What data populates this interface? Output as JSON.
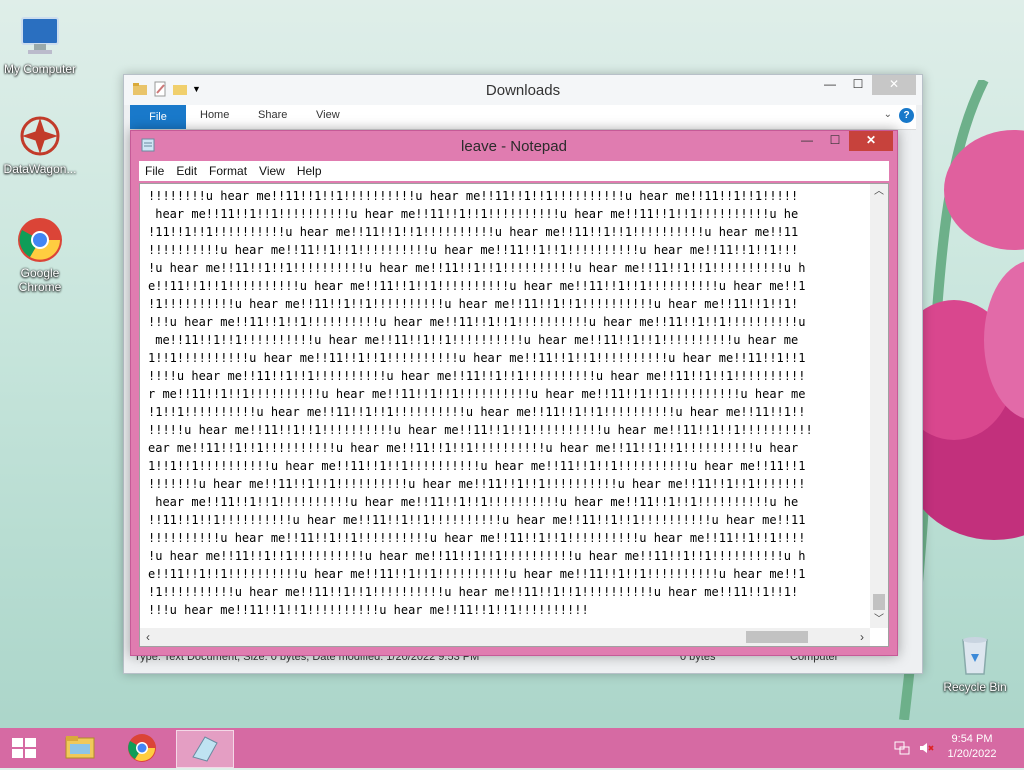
{
  "desktop": {
    "icons": [
      {
        "label": "My Computer"
      },
      {
        "label": "DataWagon..."
      },
      {
        "label": "Google Chrome"
      },
      {
        "label": "Recycle Bin"
      }
    ]
  },
  "explorer": {
    "title": "Downloads",
    "tabs": {
      "file": "File",
      "home": "Home",
      "share": "Share",
      "view": "View"
    },
    "status": {
      "left": "Type: Text Document, Size: 0 bytes, Date modified: 1/20/2022 9:53 PM",
      "size": "0 bytes",
      "location": "Computer"
    }
  },
  "notepad": {
    "title": "leave - Notepad",
    "menu": {
      "file": "File",
      "edit": "Edit",
      "format": "Format",
      "view": "View",
      "help": "Help"
    },
    "lines": [
      "!!!!!!!!u hear me!!11!!1!!1!!!!!!!!!!u hear me!!11!!1!!1!!!!!!!!!!u hear me!!11!!1!!1!!!!!",
      " hear me!!11!!1!!1!!!!!!!!!!u hear me!!11!!1!!1!!!!!!!!!!u hear me!!11!!1!!1!!!!!!!!!!u he",
      "!11!!1!!1!!!!!!!!!!u hear me!!11!!1!!1!!!!!!!!!!u hear me!!11!!1!!1!!!!!!!!!!u hear me!!11",
      "!!!!!!!!!!u hear me!!11!!1!!1!!!!!!!!!!u hear me!!11!!1!!1!!!!!!!!!!u hear me!!11!!1!!1!!!",
      "!u hear me!!11!!1!!1!!!!!!!!!!u hear me!!11!!1!!1!!!!!!!!!!u hear me!!11!!1!!1!!!!!!!!!!u h",
      "e!!11!!1!!1!!!!!!!!!!u hear me!!11!!1!!1!!!!!!!!!!u hear me!!11!!1!!1!!!!!!!!!!u hear me!!1",
      "!1!!!!!!!!!!u hear me!!11!!1!!1!!!!!!!!!!u hear me!!11!!1!!1!!!!!!!!!!u hear me!!11!!1!!1!",
      "!!!u hear me!!11!!1!!1!!!!!!!!!!u hear me!!11!!1!!1!!!!!!!!!!u hear me!!11!!1!!1!!!!!!!!!!u",
      " me!!11!!1!!1!!!!!!!!!!u hear me!!11!!1!!1!!!!!!!!!!u hear me!!11!!1!!1!!!!!!!!!!u hear me",
      "1!!1!!!!!!!!!!u hear me!!11!!1!!1!!!!!!!!!!u hear me!!11!!1!!1!!!!!!!!!!u hear me!!11!!1!!1",
      "!!!!u hear me!!11!!1!!1!!!!!!!!!!u hear me!!11!!1!!1!!!!!!!!!!u hear me!!11!!1!!1!!!!!!!!!!",
      "r me!!11!!1!!1!!!!!!!!!!u hear me!!11!!1!!1!!!!!!!!!!u hear me!!11!!1!!1!!!!!!!!!!u hear me",
      "!1!!1!!!!!!!!!!u hear me!!11!!1!!1!!!!!!!!!!u hear me!!11!!1!!1!!!!!!!!!!u hear me!!11!!1!!",
      "!!!!!u hear me!!11!!1!!1!!!!!!!!!!u hear me!!11!!1!!1!!!!!!!!!!u hear me!!11!!1!!1!!!!!!!!!!",
      "ear me!!11!!1!!1!!!!!!!!!!u hear me!!11!!1!!1!!!!!!!!!!u hear me!!11!!1!!1!!!!!!!!!!u hear",
      "1!!1!!1!!!!!!!!!!u hear me!!11!!1!!1!!!!!!!!!!u hear me!!11!!1!!1!!!!!!!!!!u hear me!!11!!1",
      "!!!!!!!u hear me!!11!!1!!1!!!!!!!!!!u hear me!!11!!1!!1!!!!!!!!!!u hear me!!11!!1!!1!!!!!!!",
      " hear me!!11!!1!!1!!!!!!!!!!u hear me!!11!!1!!1!!!!!!!!!!u hear me!!11!!1!!1!!!!!!!!!!u he",
      "!!11!!1!!1!!!!!!!!!!u hear me!!11!!1!!1!!!!!!!!!!u hear me!!11!!1!!1!!!!!!!!!!u hear me!!11",
      "!!!!!!!!!!u hear me!!11!!1!!1!!!!!!!!!!u hear me!!11!!1!!1!!!!!!!!!!u hear me!!11!!1!!1!!!!",
      "!u hear me!!11!!1!!1!!!!!!!!!!u hear me!!11!!1!!1!!!!!!!!!!u hear me!!11!!1!!1!!!!!!!!!!u h",
      "e!!11!!1!!1!!!!!!!!!!u hear me!!11!!1!!1!!!!!!!!!!u hear me!!11!!1!!1!!!!!!!!!!u hear me!!1",
      "!1!!!!!!!!!!u hear me!!11!!1!!1!!!!!!!!!!u hear me!!11!!1!!1!!!!!!!!!!u hear me!!11!!1!!1!",
      "!!!u hear me!!11!!1!!1!!!!!!!!!!u hear me!!11!!1!!1!!!!!!!!!!"
    ]
  },
  "taskbar": {
    "clock": {
      "time": "9:54 PM",
      "date": "1/20/2022"
    }
  },
  "colors": {
    "taskbar": "#d66aa3",
    "notepad_frame": "#e07cb0",
    "close_red": "#c7423c",
    "file_tab": "#1979ca"
  }
}
